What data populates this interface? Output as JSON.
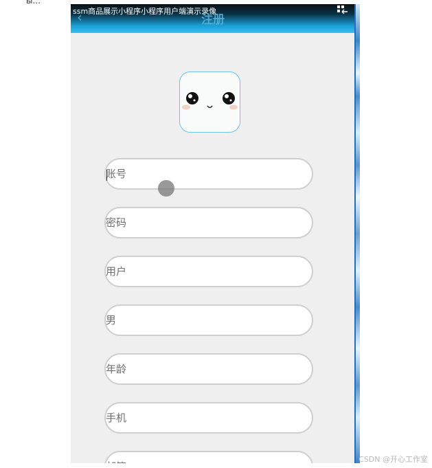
{
  "corner_text": "ы...",
  "status": {
    "recording_title": "ssm商品展示小程序小程序用户端演示录像"
  },
  "navbar": {
    "back_icon": "chevron-left-icon",
    "title": "注册",
    "menu_icon": "grid-arrow-icon"
  },
  "avatar": {
    "icon": "cute-face-icon",
    "border_color": "#6ec2e6"
  },
  "form": {
    "fields": [
      {
        "placeholder": "账号",
        "value": ""
      },
      {
        "placeholder": "密码",
        "value": ""
      },
      {
        "placeholder": "用户",
        "value": ""
      },
      {
        "placeholder": "男",
        "value": ""
      },
      {
        "placeholder": "年龄",
        "value": ""
      },
      {
        "placeholder": "手机",
        "value": ""
      },
      {
        "placeholder": "邮箱",
        "value": ""
      }
    ]
  },
  "colors": {
    "header_gradient_end": "#37c0ee",
    "page_background": "#efefef"
  },
  "watermark": "CSDN @开心工作室"
}
